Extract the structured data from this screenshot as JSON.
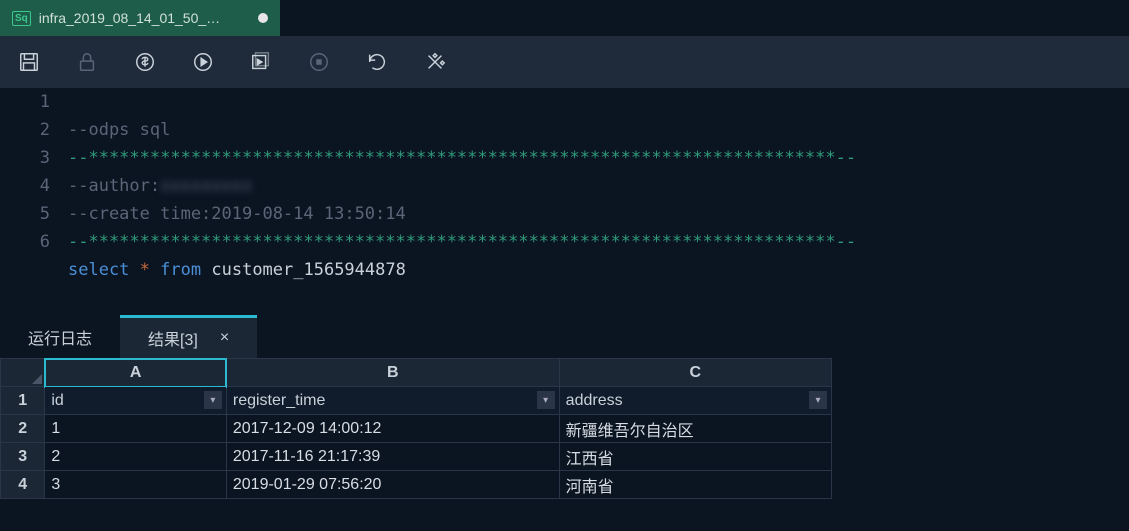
{
  "tab": {
    "icon_label": "Sq",
    "title": "infra_2019_08_14_01_50_…"
  },
  "toolbar_icons": [
    "save",
    "lock",
    "cost",
    "run",
    "run-section",
    "stop",
    "reload",
    "format"
  ],
  "code": {
    "lines": [
      {
        "n": 1,
        "type": "comment",
        "text": "--odps sql"
      },
      {
        "n": 2,
        "type": "stars",
        "text": "--*************************************************************************--"
      },
      {
        "n": 3,
        "type": "author",
        "prefix": "--author:",
        "blurred": "xxxxxxxxx"
      },
      {
        "n": 4,
        "type": "comment",
        "text": "--create time:2019-08-14 13:50:14"
      },
      {
        "n": 5,
        "type": "stars",
        "text": "--*************************************************************************--"
      },
      {
        "n": 6,
        "type": "sql",
        "kw1": "select",
        "star": "*",
        "kw2": "from",
        "ident": "customer_1565944878"
      }
    ]
  },
  "result_tabs": {
    "log_label": "运行日志",
    "result_label": "结果[3]",
    "close_label": "×"
  },
  "grid": {
    "columns": [
      "A",
      "B",
      "C"
    ],
    "fields": [
      "id",
      "register_time",
      "address"
    ],
    "rows": [
      {
        "n": 1,
        "cells": [
          "id",
          "register_time",
          "address"
        ]
      },
      {
        "n": 2,
        "cells": [
          "1",
          "2017-12-09 14:00:12",
          "新疆维吾尔自治区"
        ]
      },
      {
        "n": 3,
        "cells": [
          "2",
          "2017-11-16 21:17:39",
          "江西省"
        ]
      },
      {
        "n": 4,
        "cells": [
          "3",
          "2019-01-29 07:56:20",
          "河南省"
        ]
      }
    ]
  }
}
